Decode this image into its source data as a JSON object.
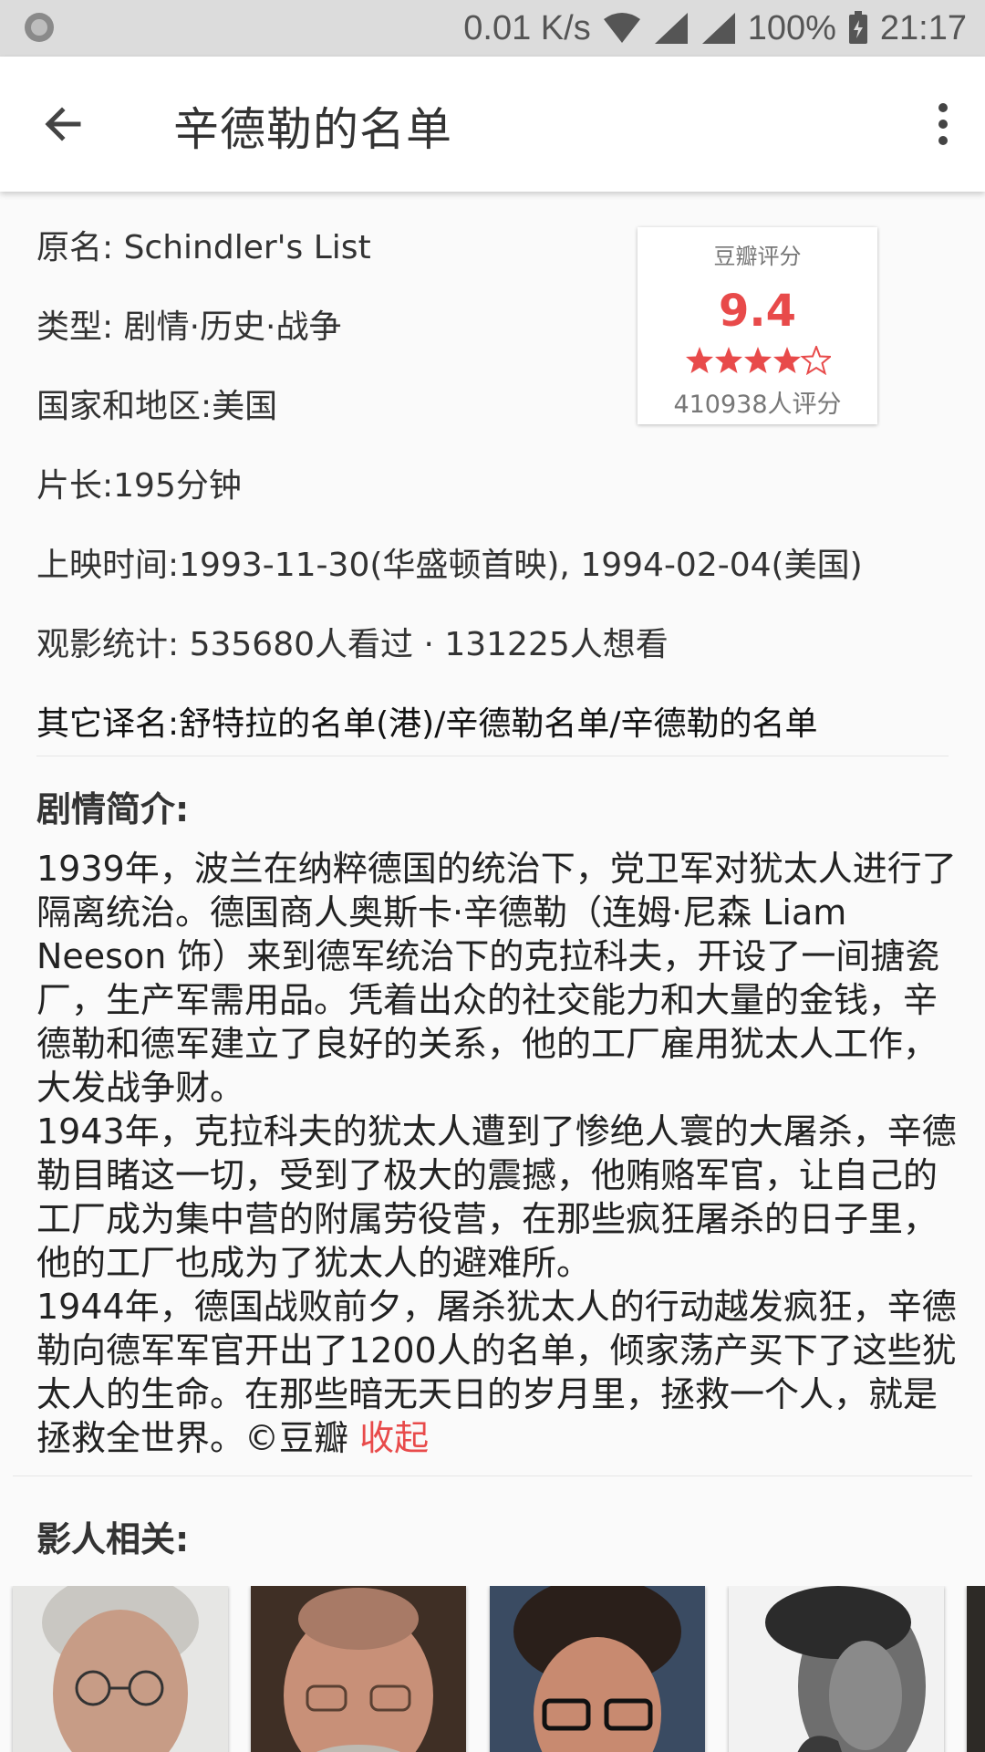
{
  "status_bar": {
    "net_speed": "0.01 K/s",
    "battery": "100%",
    "time": "21:17"
  },
  "app_bar": {
    "title": "辛德勒的名单",
    "back_icon": "arrow-back-icon",
    "more_icon": "more-vert-icon"
  },
  "info": {
    "original_name": "原名: Schindler's List",
    "genre": "类型: 剧情·历史·战争",
    "country": "国家和地区:美国",
    "duration": "片长:195分钟",
    "release": "上映时间:1993-11-30(华盛顿首映), 1994-02-04(美国)",
    "stats": "观影统计: 535680人看过 · 131225人想看",
    "aka": "其它译名:舒特拉的名单(港)/辛德勒名单/辛德勒的名单"
  },
  "rating": {
    "title": "豆瓣评分",
    "score": "9.4",
    "stars": 4.5,
    "count": "410938人评分",
    "color": "#e84a4a"
  },
  "synopsis": {
    "title": "剧情简介:",
    "paragraphs": [
      "1939年，波兰在纳粹德国的统治下，党卫军对犹太人进行了隔离统治。德国商人奥斯卡·辛德勒（连姆·尼森 Liam Neeson 饰）来到德军统治下的克拉科夫，开设了一间搪瓷厂，生产军需用品。凭着出众的社交能力和大量的金钱，辛德勒和德军建立了良好的关系，他的工厂雇用犹太人工作，大发战争财。",
      "1943年，克拉科夫的犹太人遭到了惨绝人寰的大屠杀，辛德勒目睹这一切，受到了极大的震撼，他贿赂军官，让自己的工厂成为集中营的附属劳役营，在那些疯狂屠杀的日子里，他的工厂也成为了犹太人的避难所。",
      "1944年，德国战败前夕，屠杀犹太人的行动越发疯狂，辛德勒向德军军官开出了1200人的名单，倾家荡产买下了这些犹太人的生命。在那些暗无天日的岁月里，拯救一个人，就是拯救全世界。©豆瓣"
    ],
    "collapse_label": "收起"
  },
  "people": {
    "title": "影人相关:"
  }
}
